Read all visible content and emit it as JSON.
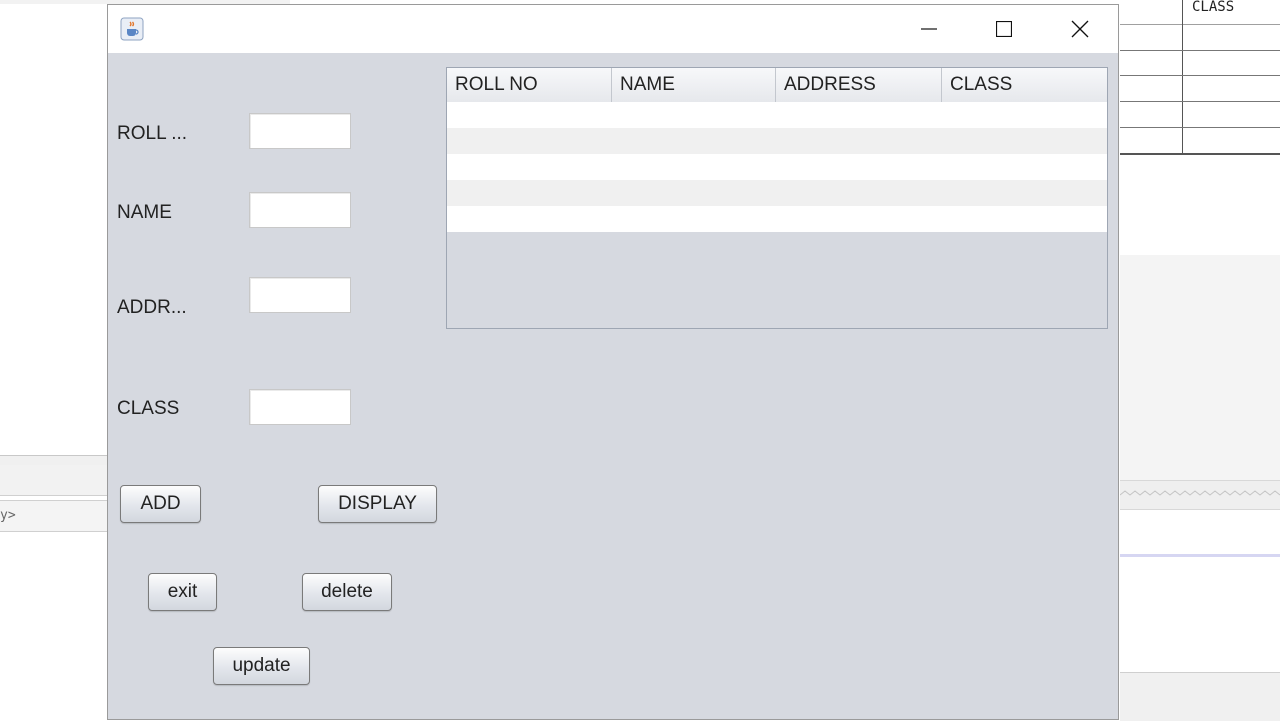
{
  "background": {
    "table_header_text": "CLASS",
    "console_fragment": "y>"
  },
  "window": {
    "title": "",
    "icon": "java-cup-icon",
    "controls": [
      "minimize-icon",
      "maximize-icon",
      "close-icon"
    ]
  },
  "form": {
    "roll_label": "ROLL ...",
    "name_label": "NAME",
    "address_label": "ADDR...",
    "class_label": "CLASS",
    "roll_value": "",
    "name_value": "",
    "address_value": "",
    "class_value": ""
  },
  "buttons": {
    "add": "ADD",
    "display": "DISPLAY",
    "exit": "exit",
    "delete": "delete",
    "update": "update"
  },
  "table": {
    "columns": [
      "ROLL NO",
      "NAME",
      "ADDRESS",
      "CLASS"
    ],
    "rows": [
      [
        "",
        "",
        "",
        ""
      ],
      [
        "",
        "",
        "",
        ""
      ],
      [
        "",
        "",
        "",
        ""
      ],
      [
        "",
        "",
        "",
        ""
      ],
      [
        "",
        "",
        "",
        ""
      ]
    ]
  },
  "colors": {
    "window_bg": "#d6d9e0",
    "row_even": "#ffffff",
    "row_odd": "#f0f0f0"
  }
}
